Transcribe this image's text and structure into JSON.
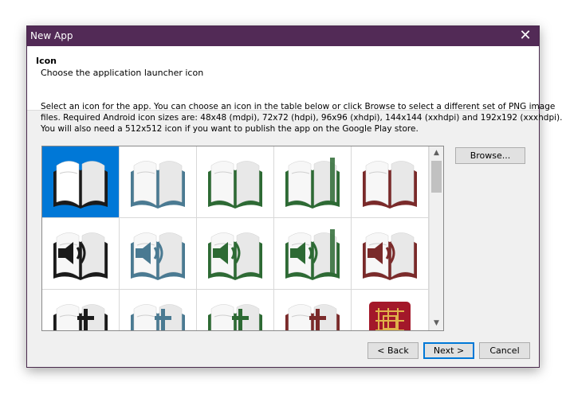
{
  "window": {
    "title": "New App"
  },
  "header": {
    "title": "Icon",
    "subtitle": "Choose the application launcher icon"
  },
  "description": {
    "line1": "Select an icon for the app. You can choose an icon in the table below or click Browse to select a different set of PNG image",
    "line2": "files. Required Android icon sizes are: 48x48 (mdpi), 72x72 (hdpi), 96x96 (xhdpi), 144x144 (xxhdpi) and 192x192 (xxxhdpi).",
    "line3": "You will also need a 512x512 icon if you want to publish the app on the Google Play store."
  },
  "buttons": {
    "browse": "Browse...",
    "back": "< Back",
    "next": "Next >",
    "cancel": "Cancel"
  },
  "icon_grid": {
    "selected_index": 0,
    "colors": {
      "black": "#1a1a1a",
      "blue": "#4a7a92",
      "green": "#2d6a34",
      "red": "#7a2a2a",
      "selected_bg": "#0078d7"
    },
    "rows": [
      [
        {
          "name": "book-white-icon"
        },
        {
          "name": "book-blue-icon"
        },
        {
          "name": "book-green-icon"
        },
        {
          "name": "book-green-ribbon-icon"
        },
        {
          "name": "book-red-icon"
        }
      ],
      [
        {
          "name": "book-speaker-black-icon"
        },
        {
          "name": "book-speaker-blue-icon"
        },
        {
          "name": "book-speaker-green-icon"
        },
        {
          "name": "book-speaker-green-ribbon-icon"
        },
        {
          "name": "book-speaker-red-icon"
        }
      ],
      [
        {
          "name": "book-cross-black-icon"
        },
        {
          "name": "book-cross-blue-icon"
        },
        {
          "name": "book-cross-green-icon"
        },
        {
          "name": "book-cross-red-icon"
        },
        {
          "name": "celtic-knot-icon"
        }
      ]
    ]
  },
  "icons": {
    "close": "close-icon",
    "scroll_up": "chevron-up-icon",
    "scroll_down": "chevron-down-icon"
  }
}
